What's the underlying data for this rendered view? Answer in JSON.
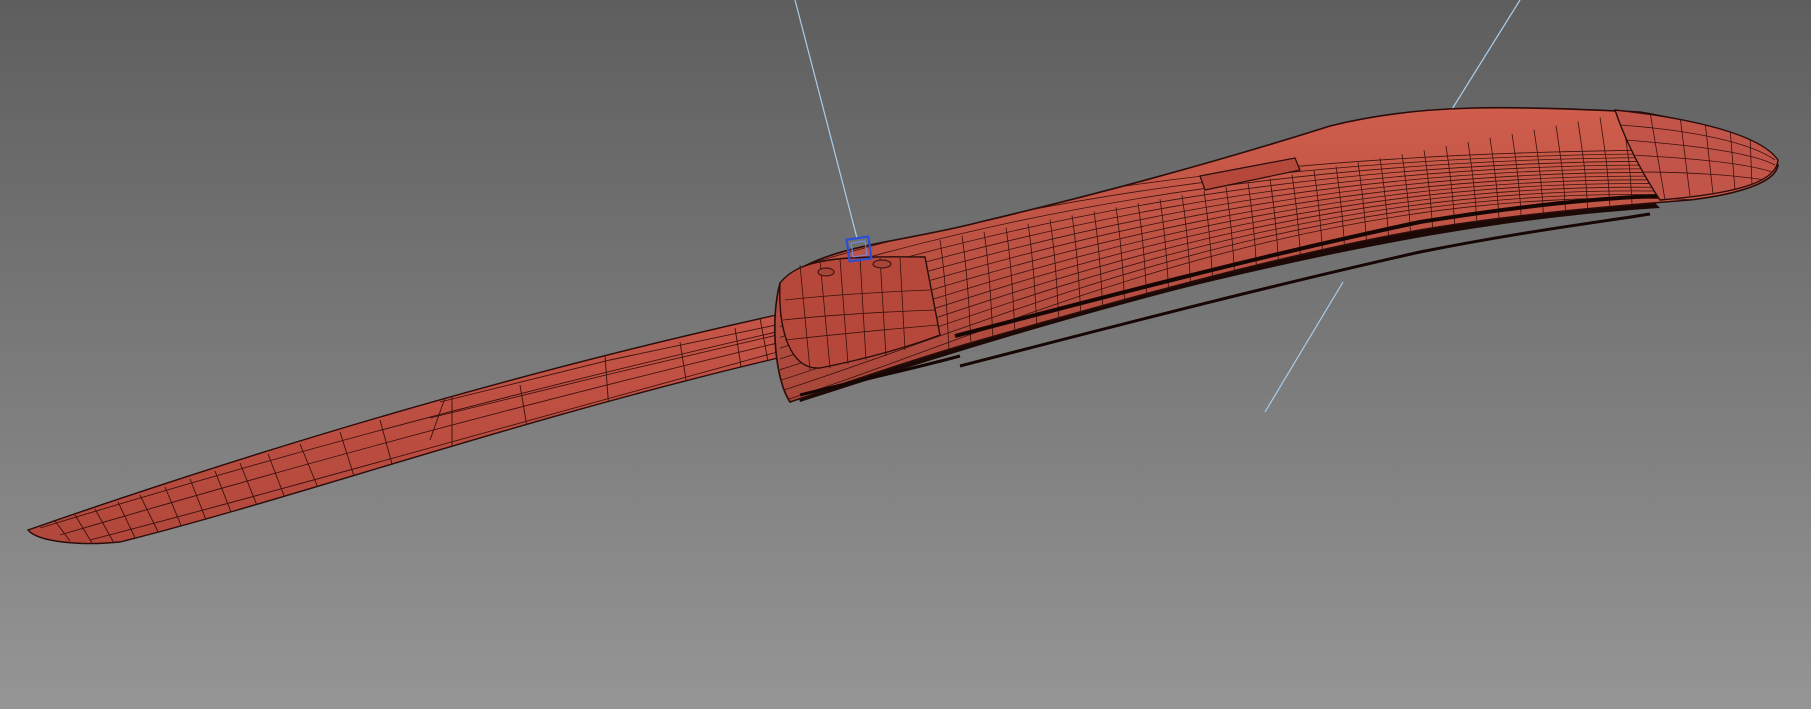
{
  "viewport": {
    "background_top": "#5e5e5e",
    "background_bottom": "#959595"
  },
  "model": {
    "display_mode": "wireframe-on-shaded",
    "surface_color": "#b84a3d",
    "highlight_color": "#cf5d4c",
    "wire_color": "#2a0d0a"
  },
  "helpers": {
    "light_line_color": "#a8cdeb",
    "selected_object_color": "#2b4fd6"
  }
}
